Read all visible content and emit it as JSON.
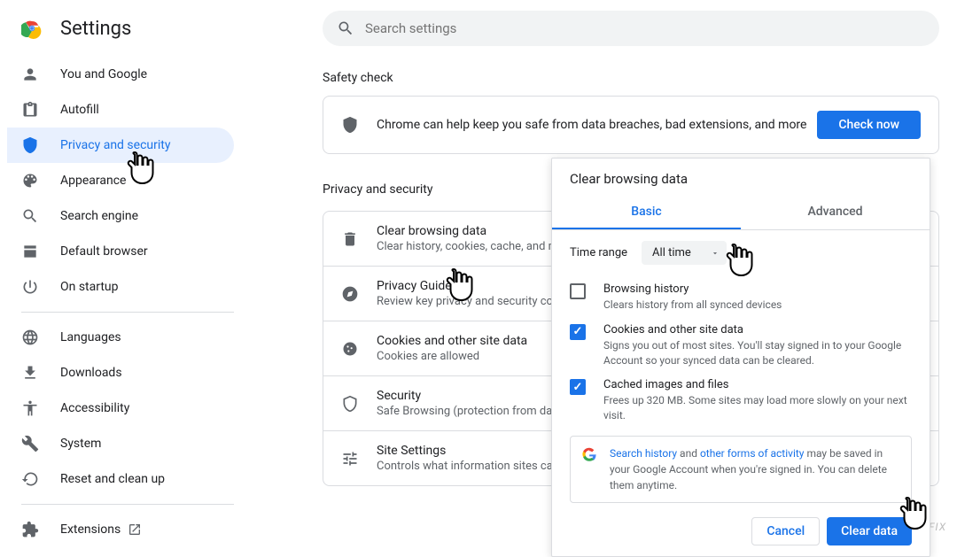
{
  "header": {
    "title": "Settings"
  },
  "search": {
    "placeholder": "Search settings"
  },
  "sidebar": {
    "items": [
      {
        "label": "You and Google"
      },
      {
        "label": "Autofill"
      },
      {
        "label": "Privacy and security"
      },
      {
        "label": "Appearance"
      },
      {
        "label": "Search engine"
      },
      {
        "label": "Default browser"
      },
      {
        "label": "On startup"
      }
    ],
    "items2": [
      {
        "label": "Languages"
      },
      {
        "label": "Downloads"
      },
      {
        "label": "Accessibility"
      },
      {
        "label": "System"
      },
      {
        "label": "Reset and clean up"
      }
    ],
    "extensions": "Extensions"
  },
  "safety": {
    "heading": "Safety check",
    "text": "Chrome can help keep you safe from data breaches, bad extensions, and more",
    "button": "Check now"
  },
  "privacy": {
    "heading": "Privacy and security",
    "rows": [
      {
        "title": "Clear browsing data",
        "sub": "Clear history, cookies, cache, and more"
      },
      {
        "title": "Privacy Guide",
        "sub": "Review key privacy and security controls"
      },
      {
        "title": "Cookies and other site data",
        "sub": "Cookies are allowed"
      },
      {
        "title": "Security",
        "sub": "Safe Browsing (protection from dangerous sites) and other security settings"
      },
      {
        "title": "Site Settings",
        "sub": "Controls what information sites can use and show"
      }
    ]
  },
  "dialog": {
    "title": "Clear browsing data",
    "tab_basic": "Basic",
    "tab_advanced": "Advanced",
    "time_label": "Time range",
    "time_value": "All time",
    "items": [
      {
        "title": "Browsing history",
        "sub": "Clears history from all synced devices",
        "checked": false
      },
      {
        "title": "Cookies and other site data",
        "sub": "Signs you out of most sites. You'll stay signed in to your Google Account so your synced data can be cleared.",
        "checked": true
      },
      {
        "title": "Cached images and files",
        "sub": "Frees up 320 MB. Some sites may load more slowly on your next visit.",
        "checked": true
      }
    ],
    "info_prefix": "Search history",
    "info_mid": " and ",
    "info_link2": "other forms of activity",
    "info_suffix": " may be saved in your Google Account when you're signed in. You can delete them anytime.",
    "cancel": "Cancel",
    "clear": "Clear data"
  },
  "watermark": "UGETFIX"
}
